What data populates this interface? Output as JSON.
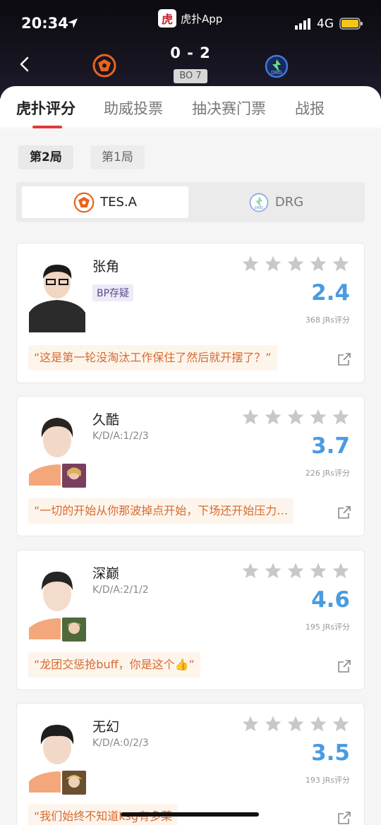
{
  "status": {
    "time": "20:34",
    "network": "4G",
    "app_name": "虎扑App",
    "app_logo_char": "虎"
  },
  "match": {
    "score": "0 - 2",
    "format": "BO 7",
    "home_team": "TES.A",
    "away_team": "DRG"
  },
  "tabs": [
    {
      "label": "虎扑评分"
    },
    {
      "label": "助威投票"
    },
    {
      "label": "抽决赛门票"
    },
    {
      "label": "战报"
    }
  ],
  "rounds": [
    {
      "label": "第2局"
    },
    {
      "label": "第1局"
    }
  ],
  "teams": [
    {
      "label": "TES.A"
    },
    {
      "label": "DRG"
    }
  ],
  "players": [
    {
      "name": "张角",
      "tag": "BP存疑",
      "score": "2.4",
      "count": "368 JRs评分",
      "quote": "“这是第一轮没淘汰工作保住了然后就开摆了？”"
    },
    {
      "name": "久酷",
      "kda": "K/D/A:1/2/3",
      "score": "3.7",
      "count": "226 JRs评分",
      "quote": "“一切的开始从你那波掉点开始，下场还开始压力…"
    },
    {
      "name": "深巅",
      "kda": "K/D/A:2/1/2",
      "score": "4.6",
      "count": "195 JRs评分",
      "quote": "“龙团交惩抢buff，你是这个👍”"
    },
    {
      "name": "无幻",
      "kda": "K/D/A:0/2/3",
      "score": "3.5",
      "count": "193 JRs评分",
      "quote": "“我们始终不知道ksg有多菜"
    }
  ],
  "colors": {
    "accent": "#e23a35",
    "score": "#4a9be0",
    "quote_text": "#d8692f",
    "star": "#c8c8c8"
  },
  "icons": [
    "location-arrow-icon",
    "signal-icon",
    "battery-icon",
    "back-icon",
    "star-icon",
    "share-icon"
  ]
}
